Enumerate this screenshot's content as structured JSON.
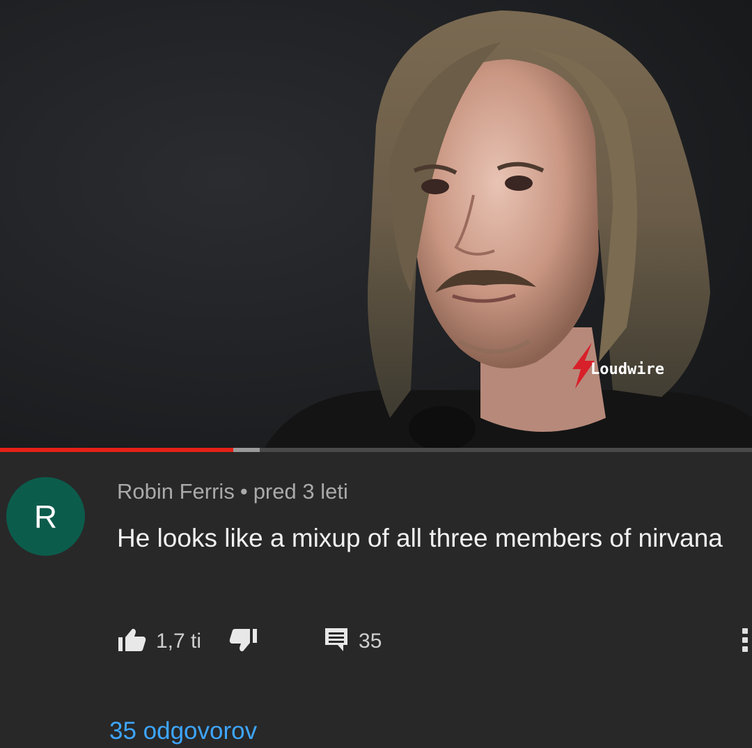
{
  "video": {
    "watermark": "Loudwire",
    "progress_fraction": 0.31,
    "buffer_fraction": 0.345
  },
  "comment": {
    "avatar_letter": "R",
    "author": "Robin Ferris",
    "separator": "•",
    "age": "pred 3 leti",
    "text": "He looks like a mixup of all three members of nirvana",
    "likes": "1,7 ti",
    "reply_count": "35",
    "replies_link": "35 odgovorov"
  },
  "icons": {
    "like": "thumbs-up-icon",
    "dislike": "thumbs-down-icon",
    "reply": "comment-icon",
    "more": "more-vertical-icon"
  },
  "colors": {
    "background": "#282828",
    "progress": "#e62117",
    "avatar": "#0c5c4c",
    "link": "#3ea6ff"
  }
}
